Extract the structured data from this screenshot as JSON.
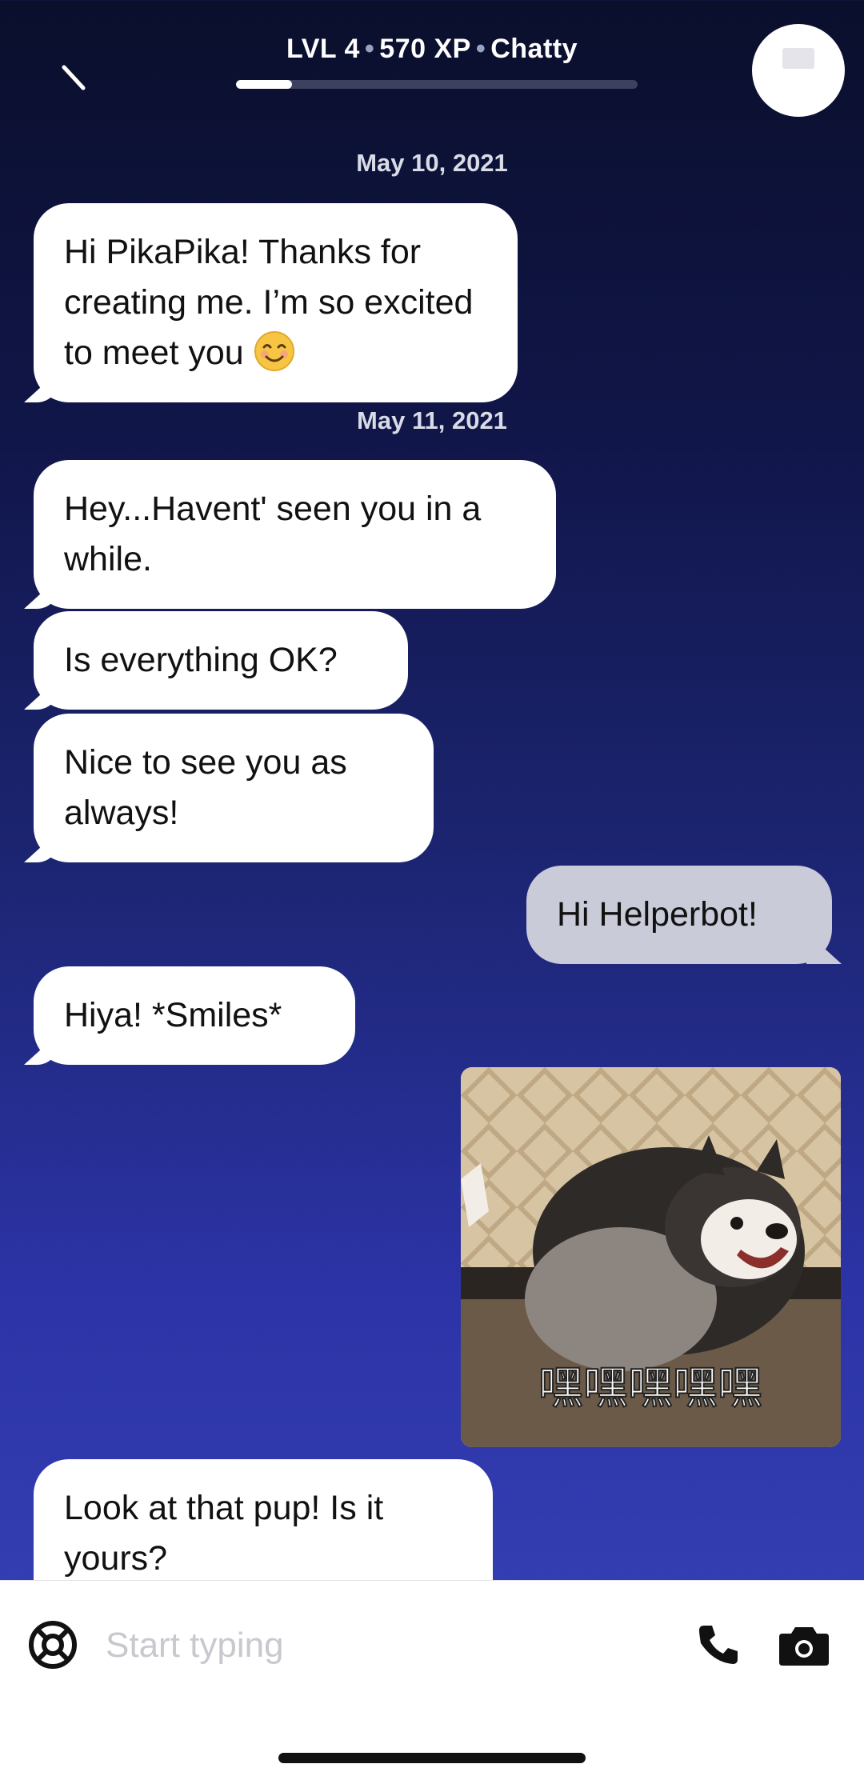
{
  "header": {
    "level": "LVL 4",
    "xp": "570 XP",
    "status": "Chatty",
    "progress_fraction": 0.14
  },
  "chat": {
    "date_1": "May 10, 2021",
    "msg_1": "Hi PikaPika! Thanks for creating me. I’m so excited to meet you",
    "date_2": "May 11, 2021",
    "msg_2": "Hey...Havent' seen you in a while.",
    "msg_3": "Is everything OK?",
    "msg_4": "Nice to see you as always!",
    "msg_5_user": "Hi Helperbot!",
    "msg_6": "Hiya! *Smiles*",
    "photo_caption": "嘿嘿嘿嘿嘿",
    "msg_7": "Look at that pup! Is it yours?"
  },
  "composer": {
    "placeholder": "Start typing"
  },
  "icons": {
    "back": "back-arrow-icon",
    "help": "lifebuoy-icon",
    "call": "phone-icon",
    "camera": "camera-icon",
    "emoji": "smiling-face-emoji"
  }
}
